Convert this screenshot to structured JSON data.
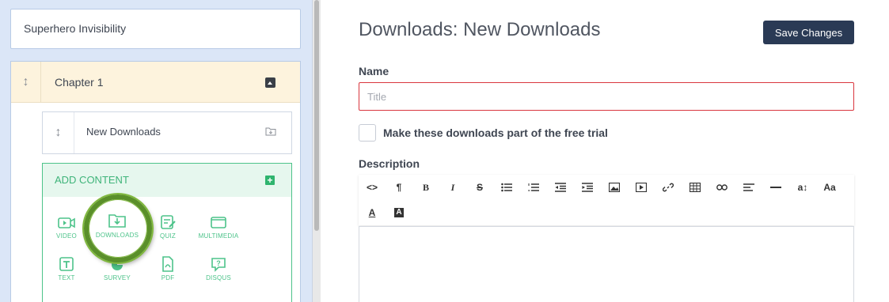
{
  "course": {
    "title": "Superhero Invisibility"
  },
  "chapter": {
    "label": "Chapter 1"
  },
  "lesson": {
    "label": "New Downloads"
  },
  "add_content": {
    "label": "ADD CONTENT",
    "types": [
      {
        "label": "VIDEO",
        "icon": "video-icon"
      },
      {
        "label": "DOWNLOADS",
        "icon": "downloads-icon"
      },
      {
        "label": "QUIZ",
        "icon": "quiz-icon"
      },
      {
        "label": "MULTIMEDIA",
        "icon": "multimedia-icon"
      },
      {
        "label": "TEXT",
        "icon": "text-icon"
      },
      {
        "label": "SURVEY",
        "icon": "survey-icon"
      },
      {
        "label": "PDF",
        "icon": "pdf-icon"
      },
      {
        "label": "DISQUS",
        "icon": "disqus-icon"
      }
    ]
  },
  "header": {
    "title": "Downloads: New Downloads",
    "save_label": "Save Changes"
  },
  "form": {
    "name_label": "Name",
    "name_placeholder": "Title",
    "free_trial_label": "Make these downloads part of the free trial",
    "description_label": "Description"
  },
  "toolbar": {
    "buttons": [
      "code-view",
      "paragraph",
      "bold",
      "italic",
      "strikethrough",
      "unordered-list",
      "ordered-list",
      "outdent",
      "indent",
      "insert-image",
      "insert-video",
      "insert-link",
      "insert-table",
      "insert-embed",
      "align",
      "horizontal-line",
      "font-size",
      "font-family",
      "text-color",
      "background-color"
    ],
    "glyphs": {
      "code": "<>",
      "paragraph": "¶",
      "bold": "B",
      "italic": "I",
      "strike": "S",
      "font_size": "a↕",
      "font_family": "Aa",
      "text_color": "A",
      "bg_color": "A"
    }
  },
  "colors": {
    "accent_green": "#4dc38a",
    "save_button": "#2a3a55",
    "error_border": "#d9363e",
    "chapter_bg": "#fdf3dd",
    "sidebar_bg": "#dbe6f7"
  }
}
